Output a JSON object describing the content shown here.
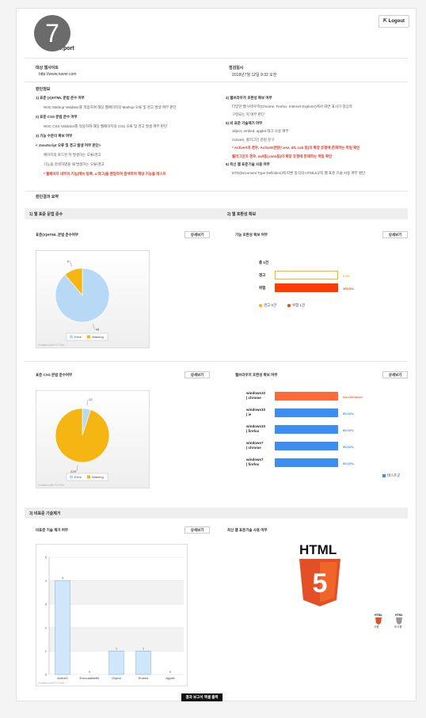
{
  "header": {
    "badge": "7",
    "logout_label": "Logout",
    "report_title": "…port"
  },
  "info": {
    "site_label": "대상 웹사이트",
    "site_value": "http://www.naver.com",
    "date_label": "점검일시",
    "date_value": "2018년7월 12일 9:32 오전"
  },
  "criteria": {
    "heading": "판단정보",
    "left": [
      {
        "t": "1) 표준 (X)HTML 문법 준수 여부",
        "s": "b"
      },
      {
        "t": "W3C Markup Validator를 적용하여 해당 웹페이지의 Markup 오류 및 경고 발생 여부 판단",
        "s": "n"
      },
      {
        "t": "2) 표준 CSS 문법 준수 여부",
        "s": "b"
      },
      {
        "t": "W3C CSS Validator를 적용하여 해당 웹페이지의 CSS 오류 및 경고 발생 여부 판단",
        "s": "n"
      },
      {
        "t": "3) 기능 수준의 확보 여부",
        "s": "b"
      },
      {
        "t": "< JavaScript 오류 및 경고 발생 여부 판단>",
        "s": "b"
      },
      {
        "t": "페이지의 로드된 뒤 발생하는 오류/경고",
        "s": "n"
      },
      {
        "t": "기능을 검색하였을 때 발생하는 오류/경고",
        "s": "n"
      },
      {
        "t": "* 웹페이지 내부의 기능(메뉴 등록, a 태그)을 랜덤하여 검색하여 해당 기능을 테스트",
        "s": "r"
      }
    ],
    "right": [
      {
        "t": "4) 웹브라우저 호환성 확보 여부",
        "s": "b"
      },
      {
        "t": "다양한 웹 브라우저(Chrome, Firefox, Internet Explorer)에서 화면 표시가 정상적",
        "s": "n"
      },
      {
        "t": "구현되는 지 여부 판단",
        "s": "n"
      },
      {
        "t": "5) 비 표준 기술제거 여부",
        "s": "b"
      },
      {
        "t": "object, embed, applet 태그 사용 여부",
        "s": "n"
      },
      {
        "t": "ActiveX, 플러그인 관련 문구",
        "s": "n"
      },
      {
        "t": "* ActiveX의 경우, ActiveX관련(*.exe, dll, cab 등)의 확장 유형에 존재하는 파일 확인",
        "s": "r"
      },
      {
        "t": "플러그인의 경우, swf등(.mov등)의 확장 유형에 존재하는 파일 확인",
        "s": "r"
      },
      {
        "t": "6) 최신 웹 표준기술 사용 여부",
        "s": "b"
      },
      {
        "t": "DTD(Document Type Definition)에 따른 방식의 HTML5규칙 웹 표준 기술 사용 여부 판단",
        "s": "n"
      }
    ]
  },
  "summary_heading": "판단결과 요약",
  "bands": {
    "web_standard": "1) 웹 표준 문법 준수",
    "compat": "2) 웹 호환성 확보",
    "nonstandard": "3) 비표준 기술제거"
  },
  "detail_label": "상세보기",
  "panels": {
    "html_title": "표준(X)HTML 문법 준수여부",
    "css_title": "표준 CSS 문법 준수여부",
    "func_title": "기능 호환성 확보 여부",
    "browser_title": "웹브라우저 호환성 확보 여부",
    "nonstd_title": "비표준 기술 제거 여부",
    "html5_title": "최신 웹 표준기술 사용 여부"
  },
  "credit": "Created with FC Free",
  "chart_data": [
    {
      "type": "pie",
      "labels": [
        "Error",
        "Warning"
      ],
      "values": [
        48,
        6
      ],
      "colors": [
        "#b8d9f5",
        "#f5b614"
      ]
    },
    {
      "type": "pie",
      "labels": [
        "Error",
        "Warning"
      ],
      "values": [
        12,
        229
      ],
      "colors": [
        "#b8d9f5",
        "#f5b614"
      ]
    },
    {
      "type": "bar",
      "orientation": "horizontal",
      "total_label": "총 1건",
      "categories": [
        "경고",
        "위험"
      ],
      "values": [
        0.0,
        100.0
      ],
      "value_labels": [
        "0.0%",
        "100.0%"
      ],
      "colors": [
        "#ffffff",
        "#ff3c00"
      ],
      "legend": [
        "경고 0건",
        "위험 1건"
      ],
      "legend_colors": [
        "#f5b614",
        "#ff3c00"
      ]
    },
    {
      "type": "bar",
      "orientation": "horizontal",
      "categories": [
        "windows10 | chrome",
        "windows10 | ie",
        "windows10 | firefox",
        "windows7 | chrome",
        "windows7 | firefox"
      ],
      "values": [
        100,
        100,
        100,
        100,
        100
      ],
      "value_labels": [
        "Non-Browser",
        "99.03%",
        "99.03%",
        "99.03%",
        "99.03%"
      ],
      "colors": [
        "#ff6a3a",
        "#3c8ef0",
        "#3c8ef0",
        "#3c8ef0",
        "#3c8ef0"
      ],
      "legend": [
        "테스트군"
      ]
    },
    {
      "type": "bar",
      "categories": [
        "ActiveX",
        "Executablefile",
        "Object",
        "Embed",
        "Applet"
      ],
      "values": [
        4,
        0,
        1,
        1,
        0
      ],
      "ylim": [
        0,
        5
      ],
      "yticks": [
        0,
        1,
        2,
        3,
        4,
        5
      ]
    }
  ],
  "html5": {
    "logo_text": "HTML",
    "shield_digit": "5",
    "icons": [
      {
        "top": "HTML",
        "bottom": "사용"
      },
      {
        "top": "HTML",
        "bottom": "미사용"
      }
    ]
  },
  "bottom_button": "결과 보고서 엑셀 출력"
}
